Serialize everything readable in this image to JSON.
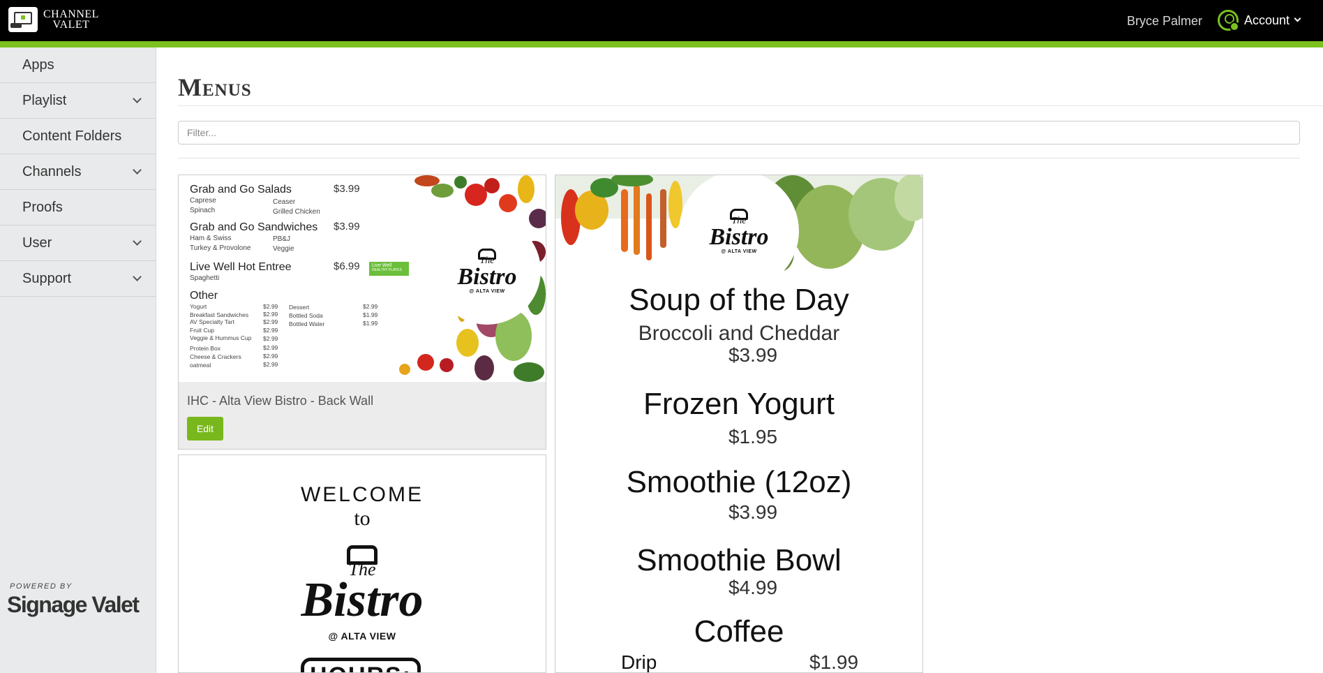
{
  "header": {
    "brand_line1": "CHANNEL",
    "brand_line2": "VALET",
    "user_name": "Bryce Palmer",
    "account_label": "Account",
    "accent_color": "#7cc11f"
  },
  "sidebar": {
    "items": [
      {
        "label": "Apps",
        "has_dropdown": false
      },
      {
        "label": "Playlist",
        "has_dropdown": true
      },
      {
        "label": "Content Folders",
        "has_dropdown": false
      },
      {
        "label": "Channels",
        "has_dropdown": true
      },
      {
        "label": "Proofs",
        "has_dropdown": false
      },
      {
        "label": "User",
        "has_dropdown": true
      },
      {
        "label": "Support",
        "has_dropdown": true
      }
    ],
    "powered_by": "POWERED BY",
    "powered_brand": "Signage Valet"
  },
  "main": {
    "title": "Menus",
    "filter_placeholder": "Filter...",
    "filter_value": ""
  },
  "cards": [
    {
      "caption": "IHC - Alta View Bistro - Back Wall",
      "edit_label": "Edit",
      "preview": {
        "sections": [
          {
            "title": "Grab and Go Salads",
            "price": "$3.99",
            "items": [
              "Caprese",
              "Ceaser",
              "Spinach",
              "Grilled Chicken"
            ]
          },
          {
            "title": "Grab and Go Sandwiches",
            "price": "$3.99",
            "items": [
              "Ham & Swiss",
              "PB&J",
              "Turkey & Provolone",
              "Veggie"
            ]
          },
          {
            "title": "Live Well Hot Entree",
            "price": "$6.99",
            "items": [
              "Spaghetti"
            ],
            "badge": "Live Well",
            "badge_sub": "HEALTHY PLATES"
          },
          {
            "title": "Other",
            "items_left": [
              {
                "name": "Yogurt",
                "price": "$2.99"
              },
              {
                "name": "Breakfast Sandwiches",
                "price": "$2.99"
              },
              {
                "name": "AV Specialty Tart",
                "price": "$2.99"
              },
              {
                "name": "Fruit Cup",
                "price": "$2.99"
              },
              {
                "name": "Veggie & Hummus Cup",
                "price": "$2.99"
              },
              {
                "name": "Protein Box",
                "price": "$2.99"
              },
              {
                "name": "Cheese & Crackers",
                "price": "$2.99"
              },
              {
                "name": "oatmeal",
                "price": "$2.99"
              }
            ],
            "items_right": [
              {
                "name": "Dessert",
                "price": "$2.99"
              },
              {
                "name": "Bottled Soda",
                "price": "$1.99"
              },
              {
                "name": "Bottled Water",
                "price": "$1.99"
              }
            ]
          }
        ],
        "logo_the": "The",
        "logo_word": "Bistro",
        "logo_sub": "@ ALTA VIEW"
      }
    },
    {
      "preview": {
        "logo_the": "The",
        "logo_word": "Bistro",
        "logo_sub": "@ ALTA VIEW",
        "items": [
          {
            "title": "Soup of the Day",
            "sub": "Broccoli and Cheddar",
            "price": "$3.99"
          },
          {
            "title": "Frozen Yogurt",
            "price": "$1.95"
          },
          {
            "title": "Smoothie (12oz)",
            "price": "$3.99"
          },
          {
            "title": "Smoothie Bowl",
            "price": "$4.99"
          },
          {
            "title": "Coffee"
          }
        ],
        "coffee_row": {
          "name": "Drip",
          "price": "$1.99"
        }
      }
    },
    {
      "preview": {
        "welcome": "WELCOME",
        "to": "to",
        "logo_the": "The",
        "logo_word": "Bistro",
        "logo_sub": "@ ALTA VIEW",
        "hours": "HOURS:"
      }
    }
  ]
}
